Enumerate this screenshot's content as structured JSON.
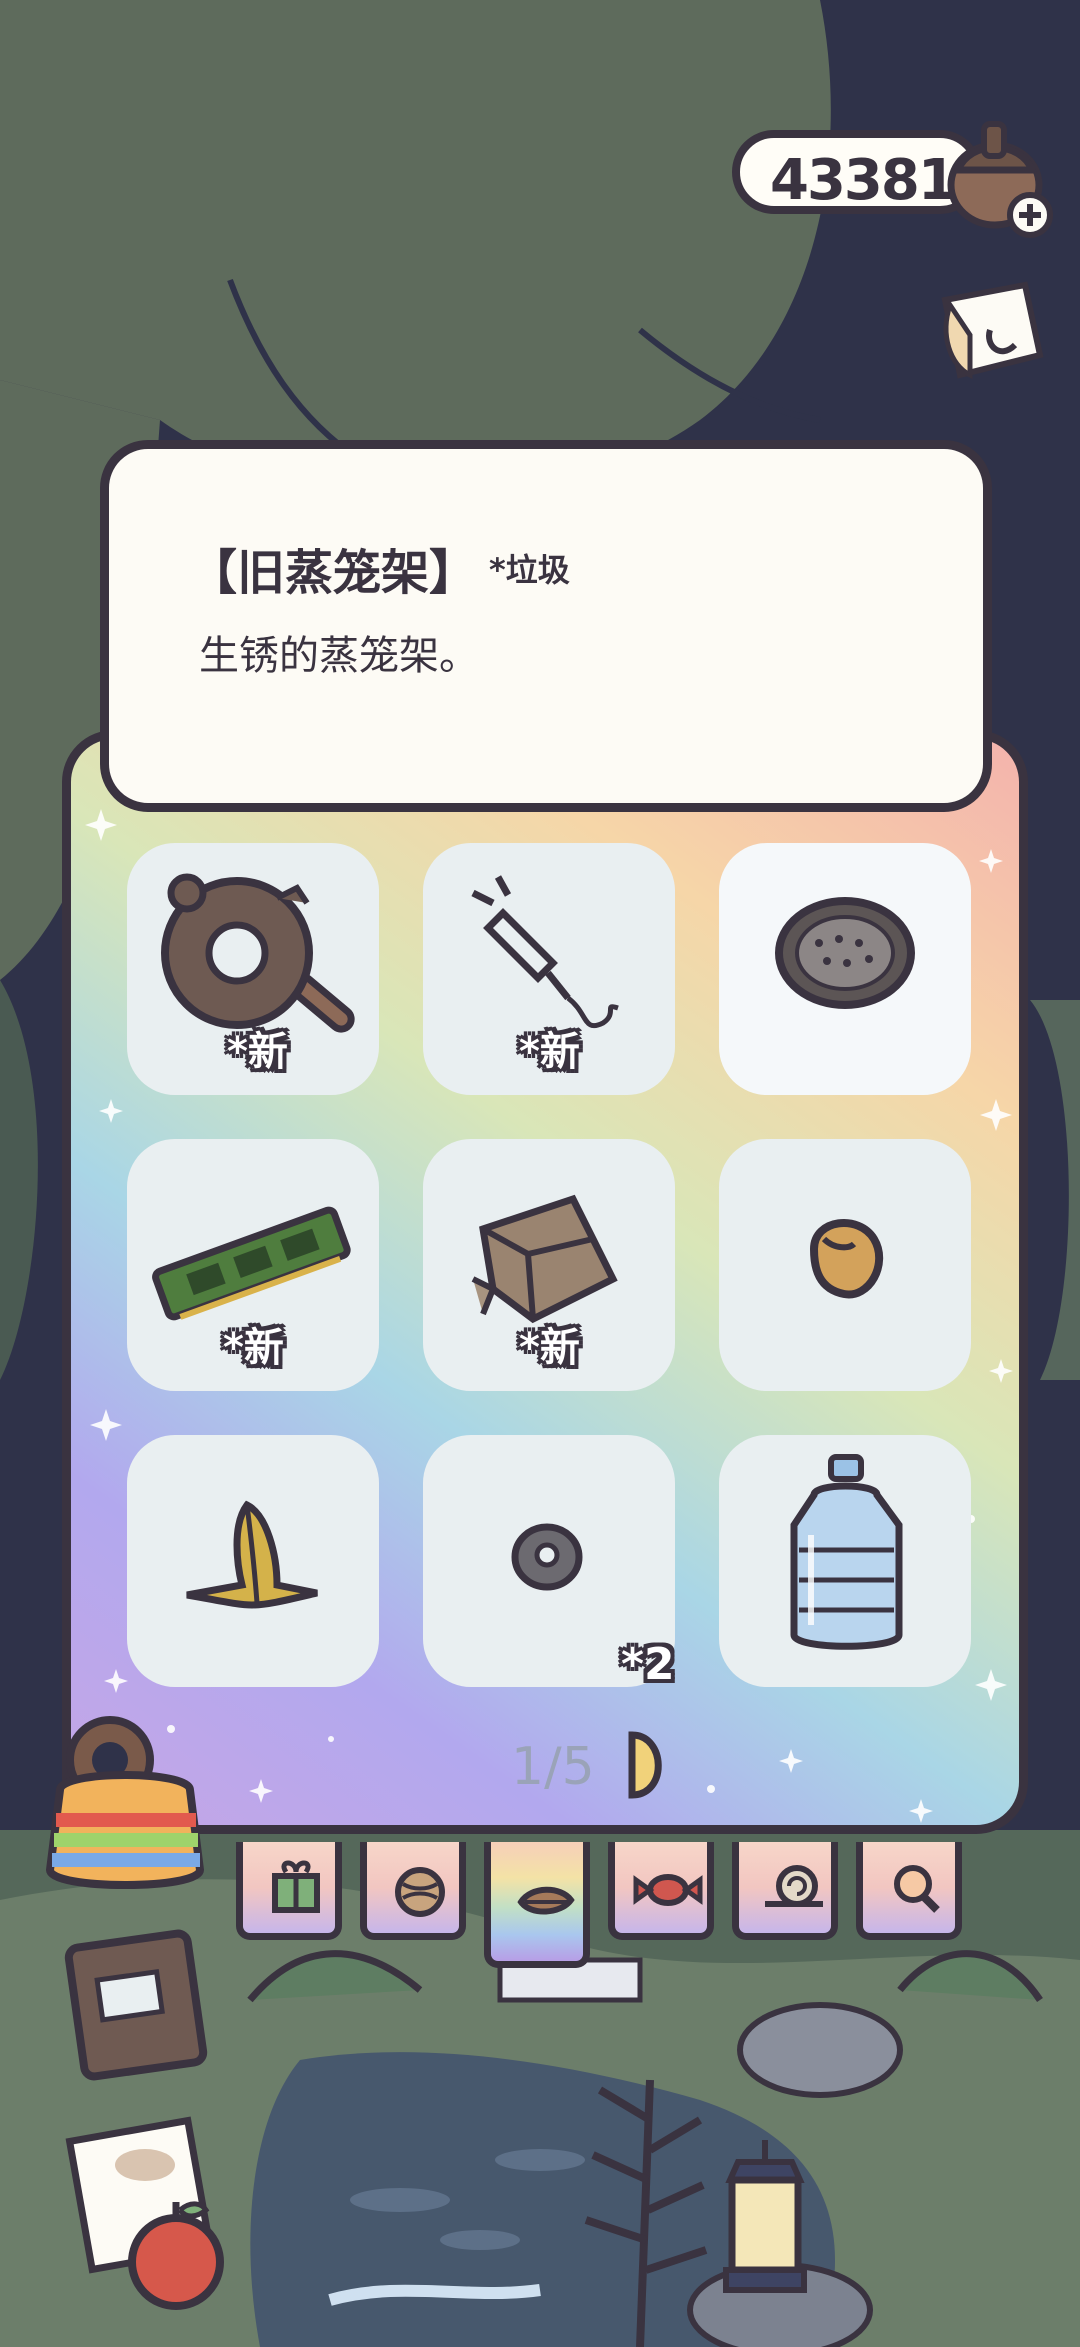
{
  "header": {
    "currency_amount": "433813"
  },
  "info_card": {
    "item_name": "【旧蒸笼架】",
    "item_tag": "*垃圾",
    "item_description": "生锈的蒸笼架。"
  },
  "inventory": {
    "slots": [
      {
        "item": "broken-donut-pan",
        "badge": "*新"
      },
      {
        "item": "plug-cable",
        "badge": "*新"
      },
      {
        "item": "steamer-rack",
        "badge": ""
      },
      {
        "item": "circuit-board",
        "badge": "*新"
      },
      {
        "item": "cardboard-box",
        "badge": "*新"
      },
      {
        "item": "bean",
        "badge": ""
      },
      {
        "item": "banana-peel",
        "badge": ""
      },
      {
        "item": "metal-nut",
        "badge": "*2"
      },
      {
        "item": "water-jug",
        "badge": ""
      }
    ],
    "page_label": "1/5"
  },
  "tabs": [
    {
      "icon": "gift-icon"
    },
    {
      "icon": "yarn-icon"
    },
    {
      "icon": "leaf-icon"
    },
    {
      "icon": "candy-icon"
    },
    {
      "icon": "snail-icon"
    },
    {
      "icon": "magnifier-icon"
    }
  ],
  "colors": {
    "outline": "#3a3340",
    "card": "#fdfbf5",
    "slot": "#e9eff1",
    "night_sky": "#2f3249",
    "tree": "#5e6b5c"
  }
}
